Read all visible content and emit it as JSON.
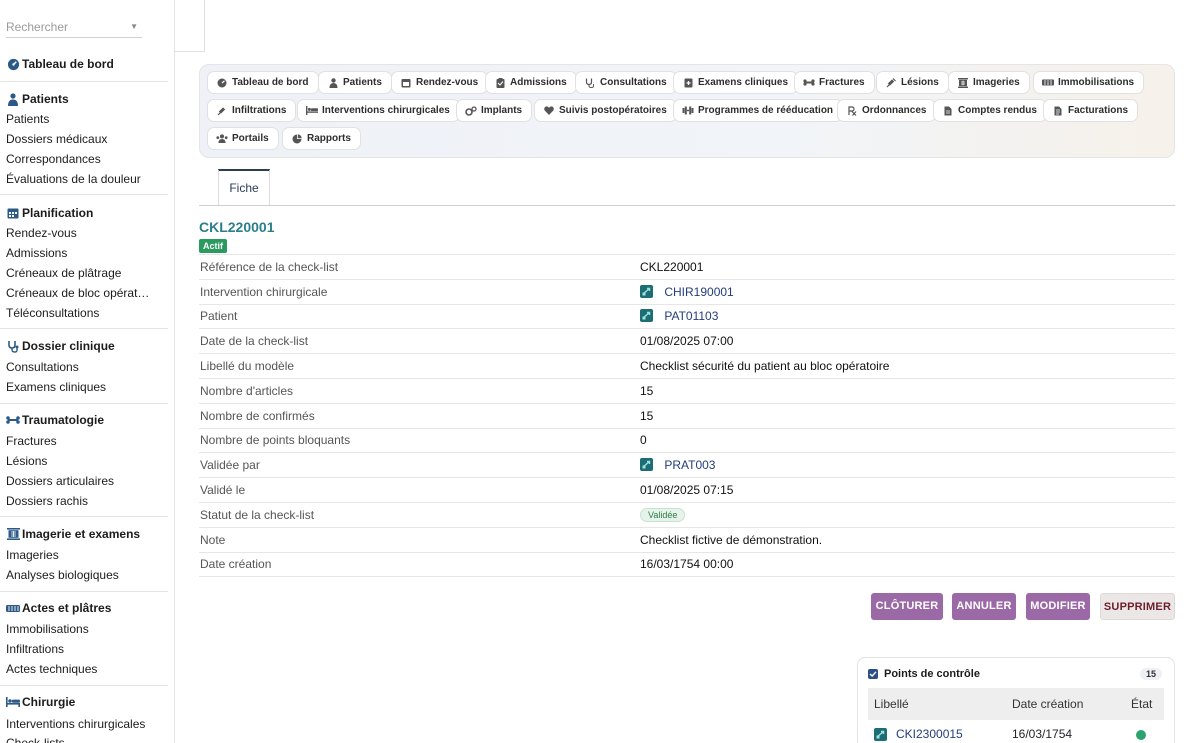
{
  "sidebar": {
    "search_placeholder": "Rechercher",
    "dashboard": "Tableau de bord",
    "sections": [
      {
        "title": "Patients",
        "items": [
          "Patients",
          "Dossiers médicaux",
          "Correspondances",
          "Évaluations de la douleur"
        ]
      },
      {
        "title": "Planification",
        "items": [
          "Rendez-vous",
          "Admissions",
          "Créneaux de plâtrage",
          "Créneaux de bloc opérat…",
          "Téléconsultations"
        ]
      },
      {
        "title": "Dossier clinique",
        "items": [
          "Consultations",
          "Examens cliniques"
        ]
      },
      {
        "title": "Traumatologie",
        "items": [
          "Fractures",
          "Lésions",
          "Dossiers articulaires",
          "Dossiers rachis"
        ]
      },
      {
        "title": "Imagerie et examens",
        "items": [
          "Imageries",
          "Analyses biologiques"
        ]
      },
      {
        "title": "Actes et plâtres",
        "items": [
          "Immobilisations",
          "Infiltrations",
          "Actes techniques"
        ]
      },
      {
        "title": "Chirurgie",
        "items": [
          "Interventions chirurgicales",
          "Check-lists"
        ]
      }
    ]
  },
  "modules": [
    "Tableau de bord",
    "Patients",
    "Rendez-vous",
    "Admissions",
    "Consultations",
    "Examens cliniques",
    "Fractures",
    "Lésions",
    "Imageries",
    "Immobilisations",
    "Infiltrations",
    "Interventions chirurgicales",
    "Implants",
    "Suivis postopératoires",
    "Programmes de rééducation",
    "Ordonnances",
    "Comptes rendus",
    "Facturations",
    "Portails",
    "Rapports"
  ],
  "tab_label": "Fiche",
  "record": {
    "title": "CKL220001",
    "status_badge": "Actif",
    "fields": [
      {
        "label": "Référence de la check-list",
        "value": "CKL220001"
      },
      {
        "label": "Intervention chirurgicale",
        "value": "CHIR190001"
      },
      {
        "label": "Patient",
        "value": "PAT01103"
      },
      {
        "label": "Date de la check-list",
        "value": "01/08/2025 07:00"
      },
      {
        "label": "Libellé du modèle",
        "value": "Checklist sécurité du patient au bloc opératoire"
      },
      {
        "label": "Nombre d'articles",
        "value": "15"
      },
      {
        "label": "Nombre de confirmés",
        "value": "15"
      },
      {
        "label": "Nombre de points bloquants",
        "value": "0"
      },
      {
        "label": "Validée par",
        "value": "PRAT003"
      },
      {
        "label": "Validé le",
        "value": "01/08/2025 07:15"
      },
      {
        "label": "Statut de la check-list",
        "value": "Validée"
      },
      {
        "label": "Note",
        "value": "Checklist fictive de démonstration."
      },
      {
        "label": "Date création",
        "value": "16/03/1754 00:00"
      }
    ]
  },
  "actions": {
    "close": "CLÔTURER",
    "cancel": "ANNULER",
    "edit": "MODIFIER",
    "delete": "SUPPRIMER"
  },
  "checkpoints": {
    "title": "Points de contrôle",
    "count": "15",
    "columns": [
      "Libellé",
      "Date création",
      "État"
    ],
    "rows": [
      {
        "label": "CKI2300015",
        "date": "16/03/1754"
      }
    ]
  },
  "colors": {
    "accent": "#2b7f8a",
    "action": "#9b6aa6",
    "success": "#2a9a5f",
    "link": "#233d7a"
  }
}
